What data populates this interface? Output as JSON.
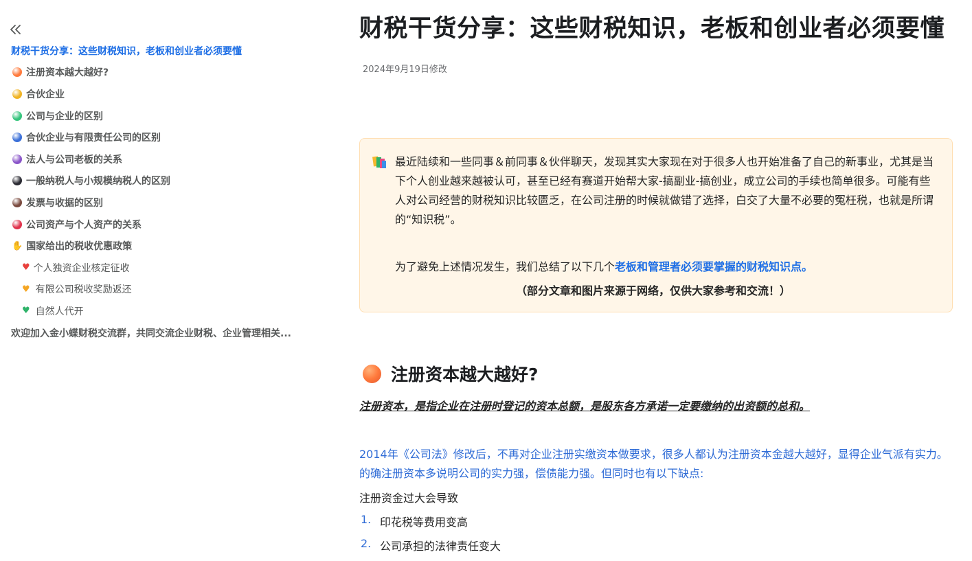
{
  "toc": {
    "items": [
      {
        "label": "财税干货分享：这些财税知识，老板和创业者必须要懂",
        "level": 0,
        "active": true,
        "icon": "none"
      },
      {
        "label": "注册资本越大越好?",
        "level": 0,
        "icon": "dot",
        "color": "#ff7a3c"
      },
      {
        "label": "合伙企业",
        "level": 0,
        "icon": "dot",
        "color": "#f0b323"
      },
      {
        "label": "公司与企业的区别",
        "level": 0,
        "icon": "dot",
        "color": "#34c47c"
      },
      {
        "label": "合伙企业与有限责任公司的区别",
        "level": 0,
        "icon": "dot",
        "color": "#3a6fd8"
      },
      {
        "label": "法人与公司老板的关系",
        "level": 0,
        "icon": "dot",
        "color": "#8a55c9"
      },
      {
        "label": "一般纳税人与小规模纳税人的区别",
        "level": 0,
        "icon": "dot",
        "color": "#2b2b33"
      },
      {
        "label": "发票与收据的区别",
        "level": 0,
        "icon": "dot",
        "color": "#7a4a3e"
      },
      {
        "label": "公司资产与个人资产的关系",
        "level": 0,
        "icon": "dot",
        "color": "#e0314b"
      },
      {
        "label": "国家给出的税收优惠政策",
        "level": 0,
        "icon": "clap",
        "color": "#f2a33a"
      },
      {
        "label": "个人独资企业核定征收",
        "level": 1,
        "icon": "heart",
        "color": "#e8413d"
      },
      {
        "label": "有限公司税收奖励返还",
        "level": 1,
        "icon": "heart",
        "color": "#f5a623"
      },
      {
        "label": "自然人代开",
        "level": 1,
        "icon": "heart",
        "color": "#2fb36a"
      },
      {
        "label": "欢迎加入金小蝶财税交流群，共同交流企业财税、企业管理相关...",
        "level": 0,
        "icon": "none"
      }
    ]
  },
  "article": {
    "title": "财税干货分享：这些财税知识，老板和创业者必须要懂",
    "modified": "2024年9月19日修改",
    "callout": {
      "icon": "books-icon",
      "p1": "最近陆续和一些同事＆前同事＆伙伴聊天，发现其实大家现在对于很多人也开始准备了自己的新事业，尤其是当下个人创业越来越被认可，甚至已经有赛道开始帮大家-搞副业-搞创业，成立公司的手续也简单很多。可能有些人对公司经营的财税知识比较匮乏，在公司注册的时候就做错了选择，白交了大量不必要的冤枉税，也就是所谓的“知识税”。",
      "p2_prefix": "为了避免上述情况发生，我们总结了以下几个",
      "p2_highlight": "老板和管理者必须要掌握的财税知识点。",
      "p3": "（部分文章和图片来源于网络，仅供大家参考和交流！）"
    },
    "section1": {
      "heading": "注册资本越大越好?",
      "definition": "注册资本，是指企业在注册时登记的资本总额，是股东各方承诺一定要缴纳的出资额的总和。",
      "blue_para": "2014年《公司法》修改后，不再对企业注册实缴资本做要求，很多人都认为注册资本金越大越好，显得企业气派有实力。的确注册资本多说明公司的实力强，偿债能力强。但同时也有以下缺点:",
      "plain": "注册资金过大会导致",
      "list": [
        {
          "num": "1.",
          "text": "印花税等费用变高"
        },
        {
          "num": "2.",
          "text": "公司承担的法律责任变大"
        }
      ]
    }
  },
  "colors": {
    "accent": "#1f6fe5",
    "callout_bg": "#fff6e8",
    "callout_border": "#ffdfb3",
    "blue_text": "#2e6bd6"
  }
}
